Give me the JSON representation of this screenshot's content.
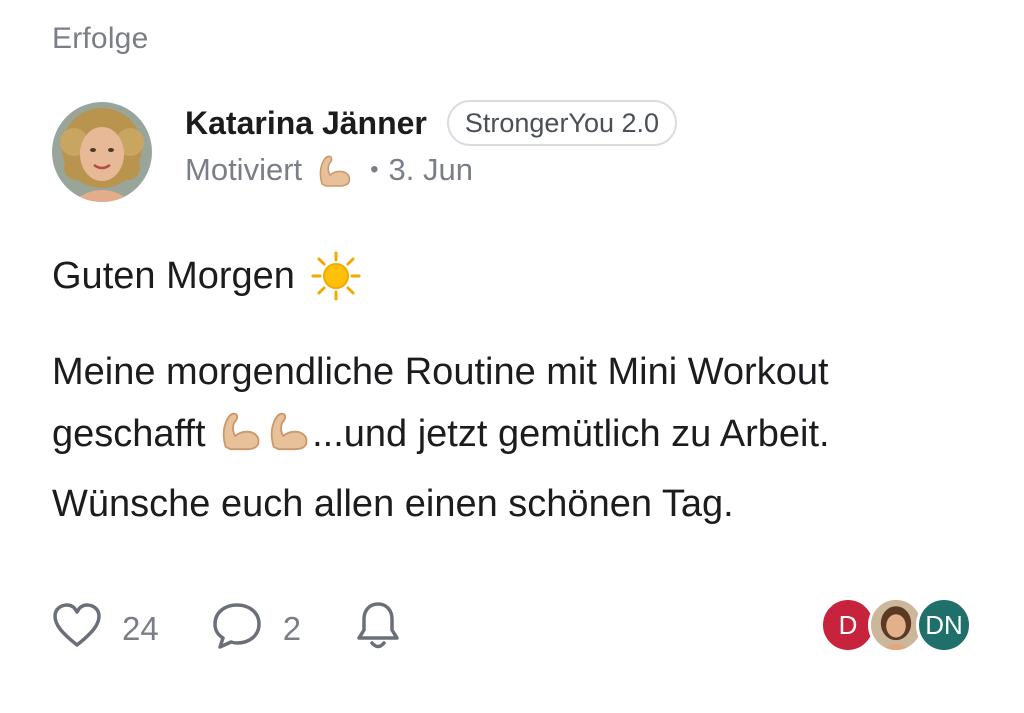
{
  "header": {
    "category": "Erfolge"
  },
  "post": {
    "author": "Katarina Jänner",
    "group": "StrongerYou 2.0",
    "mood": "Motiviert",
    "date": "3. Jun",
    "greeting": "Guten Morgen",
    "line1": "Meine morgendliche Routine mit Mini Workout",
    "line2a": "geschafft",
    "line2b": "...und jetzt gemütlich zu Arbeit.",
    "line3": "Wünsche euch allen einen schönen Tag."
  },
  "actions": {
    "likes": "24",
    "comments": "2"
  },
  "reactors": [
    {
      "initials": "D",
      "color": "#c8233c"
    },
    {
      "initials": "",
      "color": "#d9b48f",
      "type": "photo"
    },
    {
      "initials": "DN",
      "color": "#1f6f6a"
    }
  ],
  "icons": {
    "like": "heart-icon",
    "comment": "comment-bubble-icon",
    "notify": "bell-icon",
    "mood": "flexed-biceps-icon",
    "greeting": "sun-icon"
  }
}
